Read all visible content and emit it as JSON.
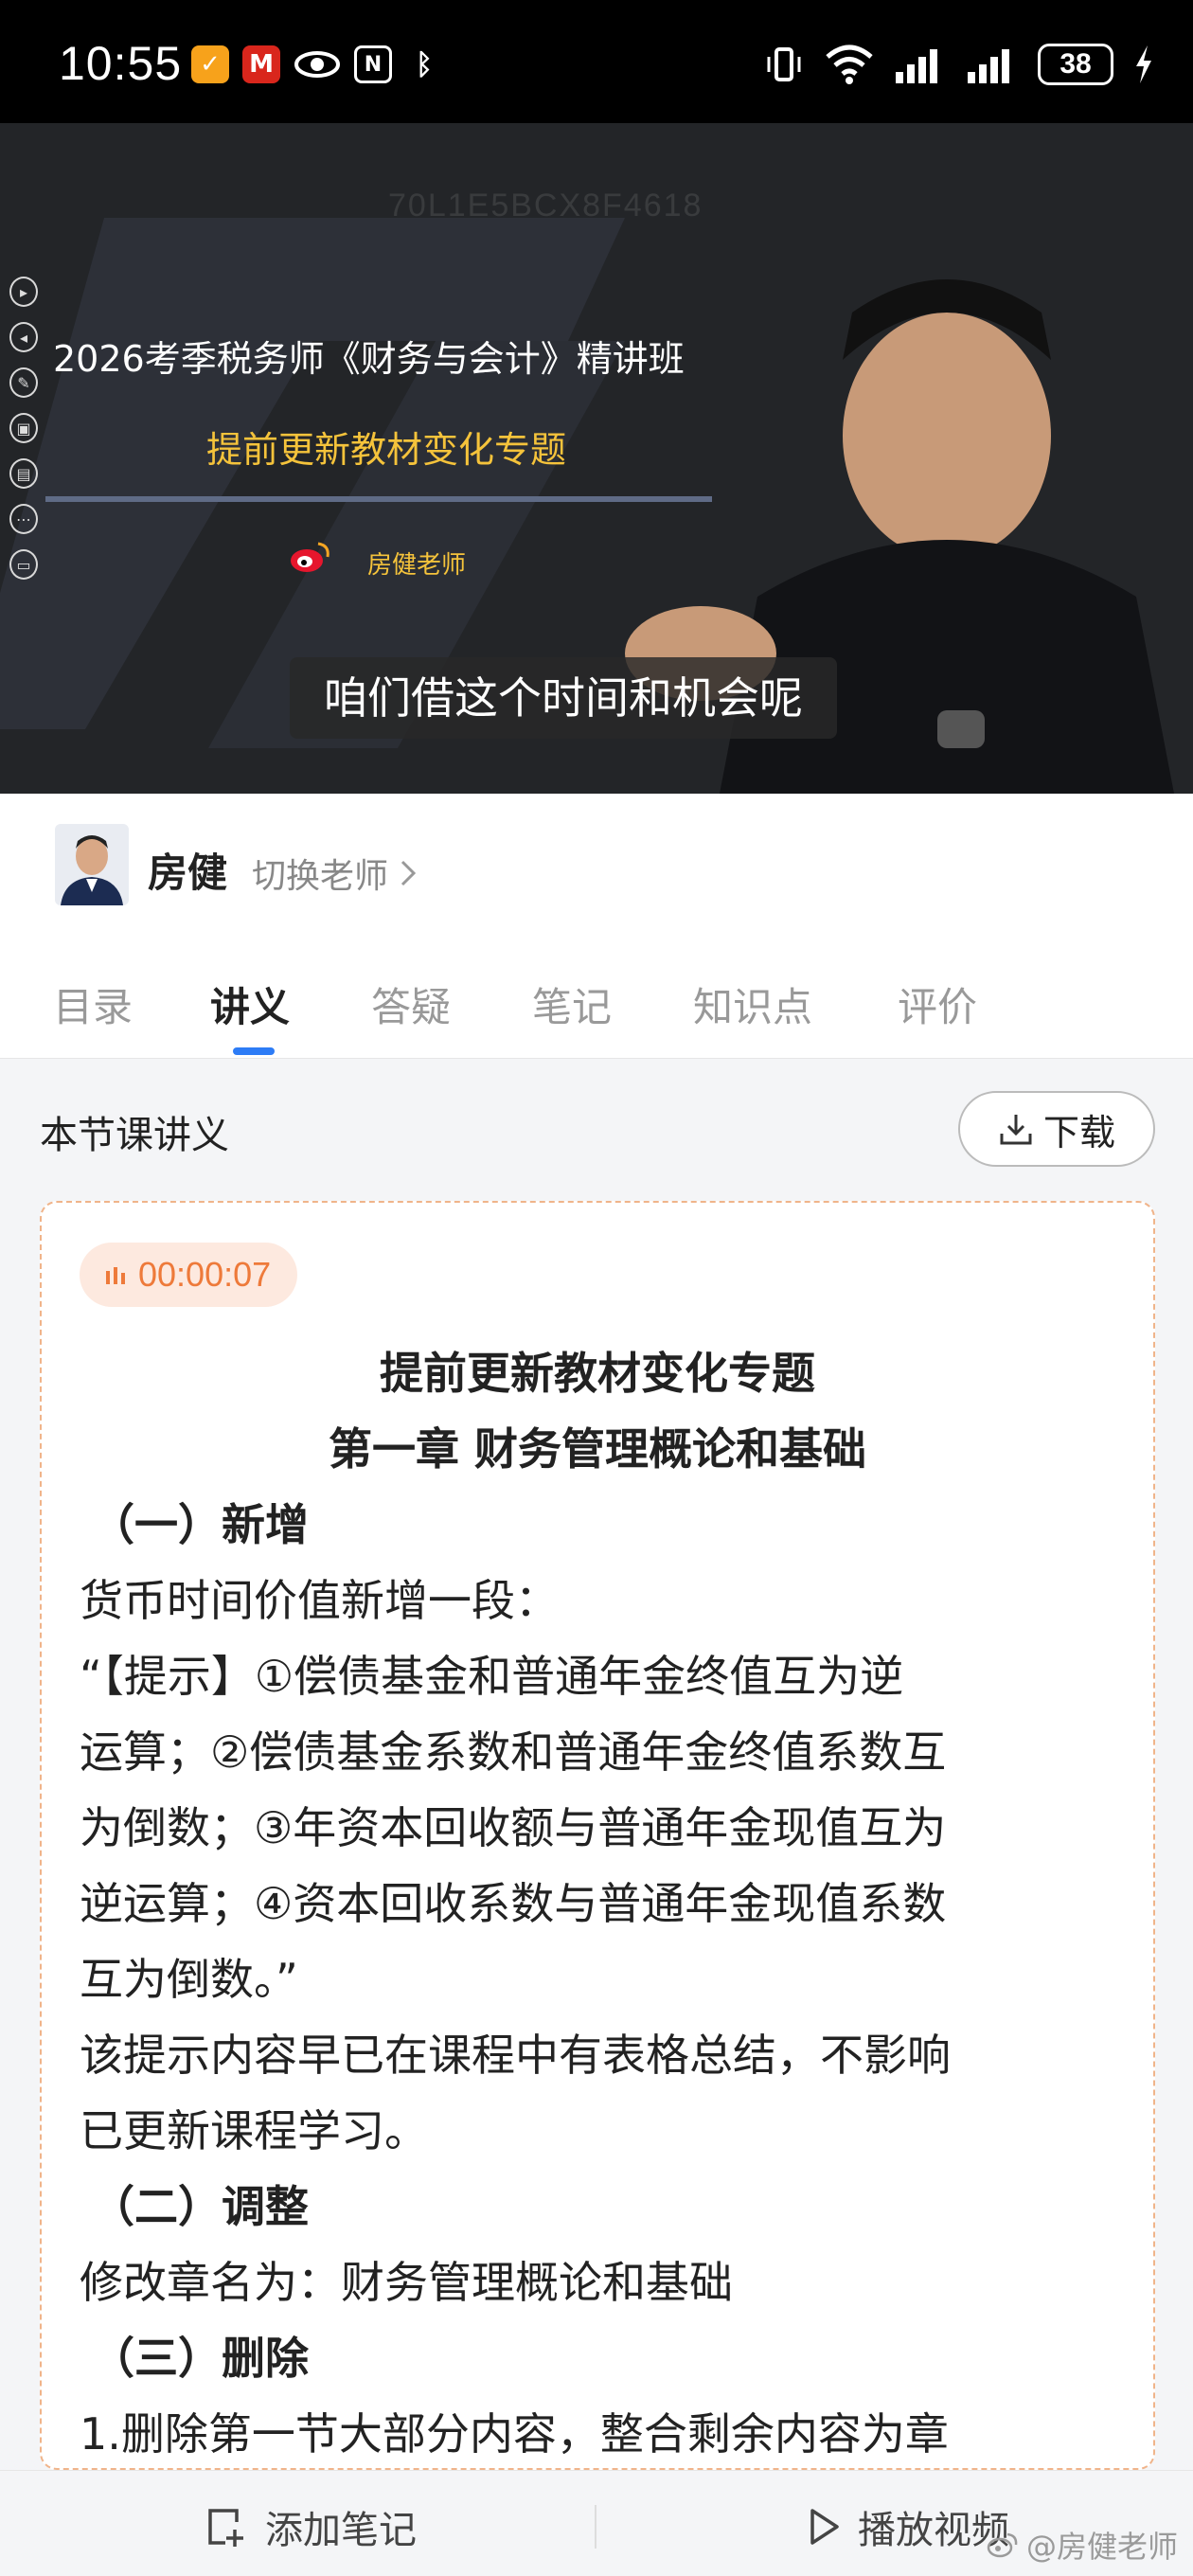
{
  "status_bar": {
    "time": "10:55",
    "battery": "38"
  },
  "video": {
    "watermark": "70L1E5BCX8F4618",
    "course_title": "2026考季税务师《财务与会计》精讲班",
    "topic": "提前更新教材变化专题",
    "weibo_name": "房健老师",
    "subtitle": "咱们借这个时间和机会呢"
  },
  "teacher": {
    "name": "房健",
    "switch_label": "切换老师"
  },
  "tabs": [
    {
      "label": "目录"
    },
    {
      "label": "讲义"
    },
    {
      "label": "答疑"
    },
    {
      "label": "笔记"
    },
    {
      "label": "知识点"
    },
    {
      "label": "评价"
    }
  ],
  "handout": {
    "label": "本节课讲义",
    "download_label": "下载",
    "timestamp": "00:00:07",
    "title_lines": [
      "提前更新教材变化专题",
      "第一章  财务管理概论和基础"
    ],
    "lines": [
      {
        "text": "（一）新增",
        "bold": true
      },
      {
        "text": "货币时间价值新增一段：",
        "bold": false
      },
      {
        "text": "“【提示】①偿债基金和普通年金终值互为逆",
        "bold": false
      },
      {
        "text": "运算；②偿债基金系数和普通年金终值系数互",
        "bold": false
      },
      {
        "text": "为倒数；③年资本回收额与普通年金现值互为",
        "bold": false
      },
      {
        "text": "逆运算；④资本回收系数与普通年金现值系数",
        "bold": false
      },
      {
        "text": "互为倒数。”",
        "bold": false
      },
      {
        "text": "该提示内容早已在课程中有表格总结，不影响",
        "bold": false
      },
      {
        "text": "已更新课程学习。",
        "bold": false
      },
      {
        "text": "（二）调整",
        "bold": true
      },
      {
        "text": "修改章名为：财务管理概论和基础",
        "bold": false
      },
      {
        "text": "（三）删除",
        "bold": true
      },
      {
        "text": "1.删除第一节大部分内容，整合剩余内容为章",
        "bold": false
      }
    ]
  },
  "bottom_bar": {
    "add_note_label": "添加笔记",
    "play_video_label": "播放视频"
  },
  "watermark": "@房健老师",
  "colors": {
    "accent": "#2d7cf6",
    "topic_yellow": "#f5c33b",
    "timestamp_orange": "#ee7a3a"
  }
}
